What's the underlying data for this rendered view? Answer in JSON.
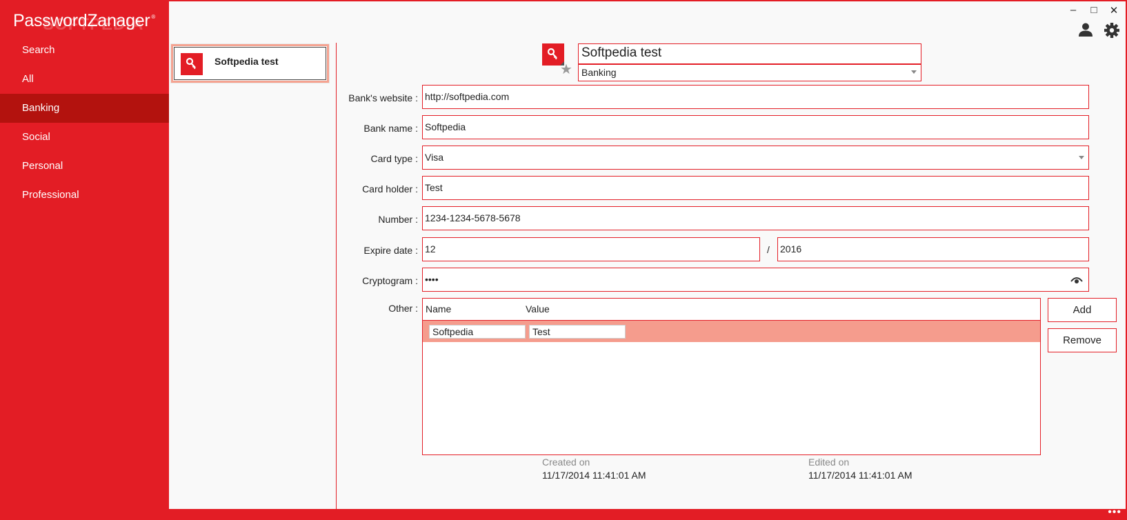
{
  "app": {
    "title": "PasswordZanager",
    "trademark": "®",
    "watermark": "SOFTPEDIA"
  },
  "sidebar": {
    "items": [
      {
        "label": "Search"
      },
      {
        "label": "All"
      },
      {
        "label": "Banking",
        "active": true
      },
      {
        "label": "Social"
      },
      {
        "label": "Personal"
      },
      {
        "label": "Professional"
      }
    ]
  },
  "window_controls": {
    "minimize": "–",
    "maximize": "□",
    "close": "✕"
  },
  "toolbar": {
    "account_icon": "user-icon",
    "settings_icon": "gear-icon"
  },
  "list": {
    "items": [
      {
        "title": "Softpedia test",
        "icon": "key-icon"
      }
    ]
  },
  "entry": {
    "title": "Softpedia test",
    "category": "Banking",
    "fields": [
      {
        "label": "Bank's website :",
        "value": "http://softpedia.com"
      },
      {
        "label": "Bank name :",
        "value": "Softpedia"
      },
      {
        "label": "Card type :",
        "value": "Visa"
      },
      {
        "label": "Card holder :",
        "value": "Test"
      },
      {
        "label": "Number :",
        "value": "1234-1234-5678-5678"
      },
      {
        "label": "Expire date :",
        "month": "12",
        "separator": "/",
        "year": "2016"
      },
      {
        "label": "Cryptogram :",
        "value": "••••"
      }
    ],
    "other": {
      "label": "Other :",
      "columns": [
        "Name",
        "Value"
      ],
      "rows": [
        {
          "name": "Softpedia",
          "value": "Test"
        }
      ],
      "add_label": "Add",
      "remove_label": "Remove"
    },
    "created_label": "Created on",
    "created_value": "11/17/2014 11:41:01 AM",
    "edited_label": "Edited on",
    "edited_value": "11/17/2014 11:41:01 AM"
  },
  "colors": {
    "accent": "#e31d25",
    "accent_dark": "#b3120e",
    "row_highlight": "#f59c8d"
  },
  "status": {
    "more": "•••"
  }
}
